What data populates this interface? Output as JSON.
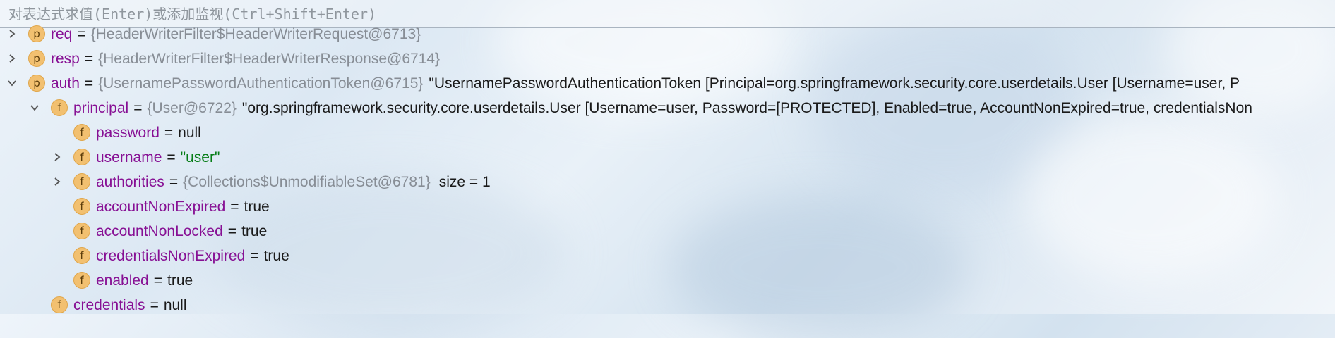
{
  "evaluate": {
    "placeholder": "对表达式求值(Enter)或添加监视(Ctrl+Shift+Enter)"
  },
  "variables": [
    {
      "kind": "p",
      "expanded": false,
      "name": "req",
      "ref": "{HeaderWriterFilter$HeaderWriterRequest@6713}",
      "value": "",
      "string": "",
      "extra": ""
    },
    {
      "kind": "p",
      "expanded": false,
      "name": "resp",
      "ref": "{HeaderWriterFilter$HeaderWriterResponse@6714}",
      "value": "",
      "string": "",
      "extra": ""
    },
    {
      "kind": "p",
      "expanded": true,
      "name": "auth",
      "ref": "{UsernamePasswordAuthenticationToken@6715}",
      "value": "",
      "string": "",
      "extra": "\"UsernamePasswordAuthenticationToken [Principal=org.springframework.security.core.userdetails.User [Username=user, P"
    },
    {
      "kind": "f",
      "expanded": true,
      "name": "principal",
      "ref": "{User@6722}",
      "value": "",
      "string": "",
      "extra": "\"org.springframework.security.core.userdetails.User [Username=user, Password=[PROTECTED], Enabled=true, AccountNonExpired=true, credentialsNon"
    },
    {
      "kind": "f",
      "expanded": null,
      "name": "password",
      "ref": "",
      "value": "null",
      "string": "",
      "extra": ""
    },
    {
      "kind": "f",
      "expanded": false,
      "name": "username",
      "ref": "",
      "value": "",
      "string": "\"user\"",
      "extra": ""
    },
    {
      "kind": "f",
      "expanded": false,
      "name": "authorities",
      "ref": "{Collections$UnmodifiableSet@6781}",
      "value": "",
      "string": "",
      "extra": "size = 1"
    },
    {
      "kind": "f",
      "expanded": null,
      "name": "accountNonExpired",
      "ref": "",
      "value": "true",
      "string": "",
      "extra": ""
    },
    {
      "kind": "f",
      "expanded": null,
      "name": "accountNonLocked",
      "ref": "",
      "value": "true",
      "string": "",
      "extra": ""
    },
    {
      "kind": "f",
      "expanded": null,
      "name": "credentialsNonExpired",
      "ref": "",
      "value": "true",
      "string": "",
      "extra": ""
    },
    {
      "kind": "f",
      "expanded": null,
      "name": "enabled",
      "ref": "",
      "value": "true",
      "string": "",
      "extra": ""
    },
    {
      "kind": "f",
      "expanded": null,
      "name": "credentials",
      "ref": "",
      "value": "null",
      "string": "",
      "extra": ""
    }
  ],
  "colors": {
    "field_name": "#871094",
    "reference": "#878d95",
    "string_literal": "#067d17",
    "badge_fill": "#f2c070"
  },
  "icons": {
    "expand": "chevron-right-icon",
    "collapse": "chevron-down-icon",
    "parameter": "parameter-badge-icon",
    "field": "field-badge-icon"
  }
}
